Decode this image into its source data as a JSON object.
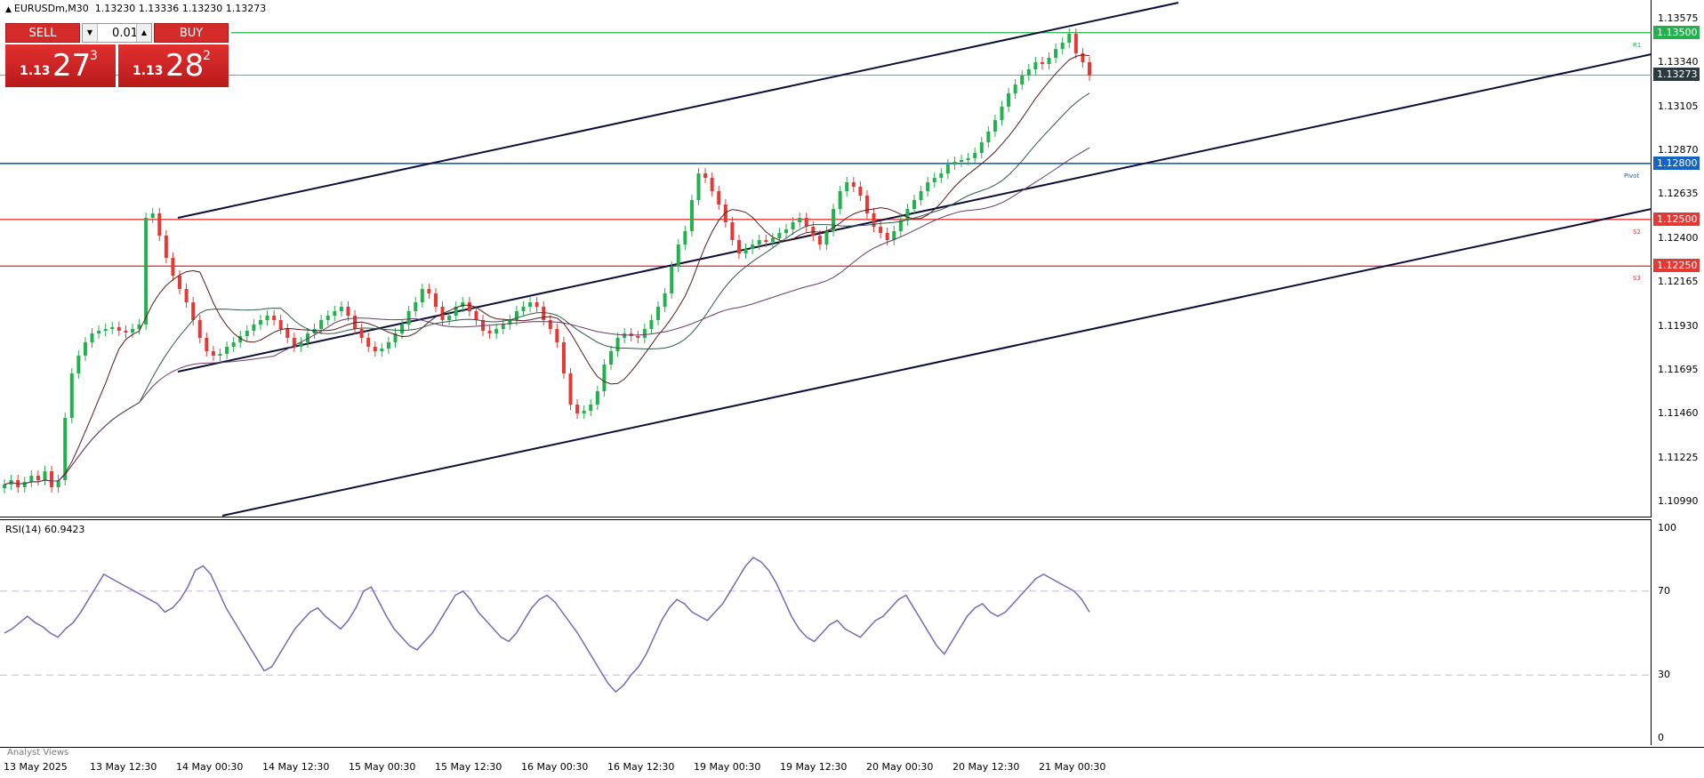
{
  "header": {
    "symbol": "EURUSDm,M30",
    "ohlc": "1.13230 1.13336 1.13230 1.13273"
  },
  "trade_panel": {
    "sell_label": "SELL",
    "buy_label": "BUY",
    "lot_value": "0.01",
    "sell_price": {
      "prefix": "1.13",
      "big": "27",
      "sup": "3"
    },
    "buy_price": {
      "prefix": "1.13",
      "big": "28",
      "sup": "2"
    }
  },
  "price_axis": {
    "ticks": [
      "1.13575",
      "1.13340",
      "1.13105",
      "1.12870",
      "1.12635",
      "1.12400",
      "1.12165",
      "1.11930",
      "1.11695",
      "1.11460",
      "1.11225",
      "1.10990"
    ],
    "tags": [
      {
        "value": "1.13500",
        "color": "#22b14c"
      },
      {
        "value": "1.13273",
        "color": "#2b3a3e"
      },
      {
        "value": "1.12800",
        "color": "#1565c0"
      },
      {
        "value": "1.12500",
        "color": "#e53935"
      },
      {
        "value": "1.12250",
        "color": "#e53935"
      }
    ]
  },
  "levels": {
    "r1": {
      "label": "R1",
      "price": 1.135
    },
    "pivot": {
      "label": "Pivot",
      "price": 1.128
    },
    "s2": {
      "label": "S2",
      "price": 1.125
    },
    "s3": {
      "label": "S3",
      "price": 1.1225
    },
    "last": 1.13273
  },
  "rsi": {
    "title": "RSI(14) 60.9423",
    "ticks": [
      "100",
      "70",
      "30",
      "0"
    ],
    "levels": [
      70,
      30
    ]
  },
  "time_axis": [
    "13 May 2025",
    "13 May 12:30",
    "14 May 00:30",
    "14 May 12:30",
    "15 May 00:30",
    "15 May 12:30",
    "16 May 00:30",
    "16 May 12:30",
    "19 May 00:30",
    "19 May 12:30",
    "20 May 00:30",
    "20 May 12:30",
    "21 May 00:30"
  ],
  "footer": {
    "analyst_views": "Analyst Views"
  },
  "colors": {
    "bull": "#22b14c",
    "bear": "#e53935",
    "channel": "#0d0d3a",
    "rsi": "#7b68b5",
    "ma1": "#5a1a1a",
    "ma2": "#2d5a4a",
    "ma3": "#6a3a6a"
  }
}
